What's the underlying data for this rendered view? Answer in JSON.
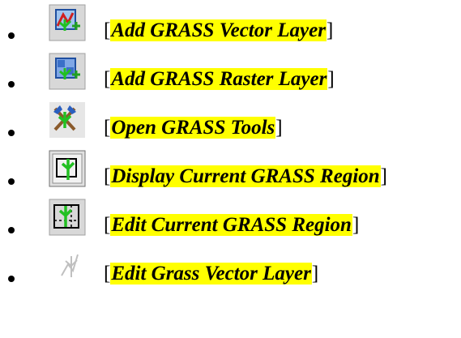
{
  "items": [
    {
      "label": "Add GRASS Vector Layer",
      "icon": "add-grass-vector-layer-icon"
    },
    {
      "label": "Add GRASS Raster Layer",
      "icon": "add-grass-raster-layer-icon"
    },
    {
      "label": "Open GRASS Tools",
      "icon": "open-grass-tools-icon"
    },
    {
      "label": "Display Current GRASS Region",
      "icon": "display-grass-region-icon"
    },
    {
      "label": "Edit Current GRASS Region",
      "icon": "edit-grass-region-icon"
    },
    {
      "label": "Edit Grass Vector Layer",
      "icon": "edit-grass-vector-layer-icon"
    }
  ],
  "brackets": {
    "open": "[",
    "close": "]"
  },
  "colors": {
    "highlight": "#ffff00",
    "grass_green": "#22c022"
  }
}
